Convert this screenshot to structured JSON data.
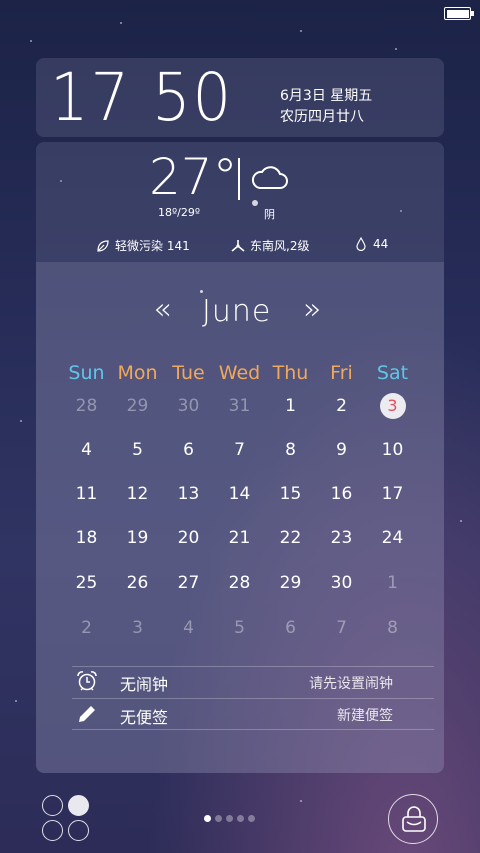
{
  "clock": {
    "time": "17 50",
    "date": "6月3日  星期五",
    "lunar": "农历四月廿八"
  },
  "weather": {
    "temp": "27°",
    "range": "18º/29º",
    "condition": "阴",
    "condition_icon": "cloud-icon",
    "air": "轻微污染 141",
    "wind": "东南风,2级",
    "humidity": "44"
  },
  "calendar": {
    "prev": "«",
    "next": "»",
    "month": "June",
    "weekdays": [
      {
        "label": "Sun",
        "color": "#5ec7e8"
      },
      {
        "label": "Mon",
        "color": "#f0a95a"
      },
      {
        "label": "Tue",
        "color": "#f0a95a"
      },
      {
        "label": "Wed",
        "color": "#f0a95a"
      },
      {
        "label": "Thu",
        "color": "#f0a95a"
      },
      {
        "label": "Fri",
        "color": "#f0a95a"
      },
      {
        "label": "Sat",
        "color": "#5ec7e8"
      }
    ],
    "weeks": [
      [
        "28",
        "29",
        "30",
        "31",
        "1",
        "2",
        "3"
      ],
      [
        "4",
        "5",
        "6",
        "7",
        "8",
        "9",
        "10"
      ],
      [
        "11",
        "12",
        "13",
        "14",
        "15",
        "16",
        "17"
      ],
      [
        "18",
        "19",
        "20",
        "21",
        "22",
        "23",
        "24"
      ],
      [
        "25",
        "26",
        "27",
        "28",
        "29",
        "30",
        "1"
      ],
      [
        "2",
        "3",
        "4",
        "5",
        "6",
        "7",
        "8"
      ]
    ],
    "today": "3"
  },
  "alarm": {
    "label": "无闹钟",
    "action": "请先设置闹钟"
  },
  "note": {
    "label": "无便签",
    "action": "新建便签"
  },
  "pager": {
    "count": 5,
    "active": 0
  }
}
